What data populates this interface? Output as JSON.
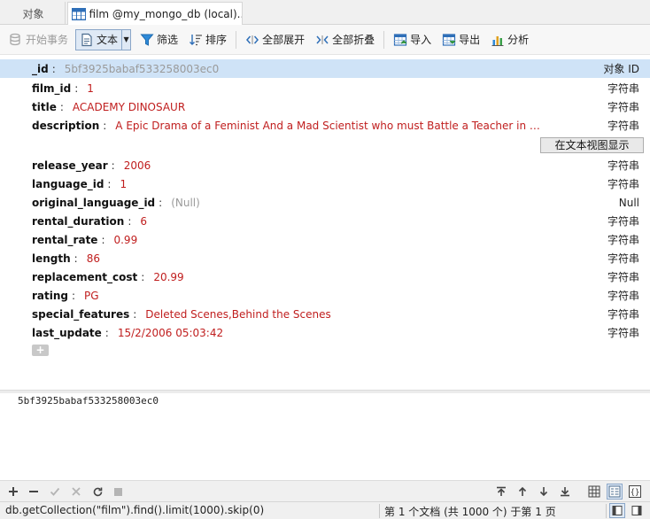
{
  "tabs": {
    "objects": "对象",
    "film": "film @my_mongo_db (local)..."
  },
  "toolbar": {
    "begin_transaction": "开始事务",
    "text": "文本",
    "filter": "筛选",
    "sort": "排序",
    "expand_all": "全部展开",
    "collapse_all": "全部折叠",
    "import": "导入",
    "export": "导出",
    "analyze": "分析"
  },
  "record": {
    "fields": [
      {
        "key": "_id",
        "value": "5bf3925babaf533258003ec0",
        "type": "对象 ID"
      },
      {
        "key": "film_id",
        "value": "1",
        "type": "字符串"
      },
      {
        "key": "title",
        "value": "ACADEMY DINOSAUR",
        "type": "字符串"
      },
      {
        "key": "description",
        "value": "A Epic Drama of a Feminist And a Mad Scientist who must Battle a Teacher in Th...",
        "type": "字符串"
      },
      {
        "key": "release_year",
        "value": "2006",
        "type": "字符串"
      },
      {
        "key": "language_id",
        "value": "1",
        "type": "字符串"
      },
      {
        "key": "original_language_id",
        "value": "(Null)",
        "type": "Null"
      },
      {
        "key": "rental_duration",
        "value": "6",
        "type": "字符串"
      },
      {
        "key": "rental_rate",
        "value": "0.99",
        "type": "字符串"
      },
      {
        "key": "length",
        "value": "86",
        "type": "字符串"
      },
      {
        "key": "replacement_cost",
        "value": "20.99",
        "type": "字符串"
      },
      {
        "key": "rating",
        "value": "PG",
        "type": "字符串"
      },
      {
        "key": "special_features",
        "value": "Deleted Scenes,Behind the Scenes",
        "type": "字符串"
      },
      {
        "key": "last_update",
        "value": "15/2/2006 05:03:42",
        "type": "字符串"
      }
    ],
    "text_view_button": "在文本视图显示",
    "add_button": "+"
  },
  "preview": {
    "text": "5bf3925babaf533258003ec0"
  },
  "status": {
    "query": "db.getCollection(\"film\").find().limit(1000).skip(0)",
    "position": "第 1 个文档  (共 1000 个) 于第 1 页"
  },
  "colors": {
    "accent": "#2f6fb8",
    "value": "#c01e1e",
    "selected_row": "#cfe3f7"
  }
}
